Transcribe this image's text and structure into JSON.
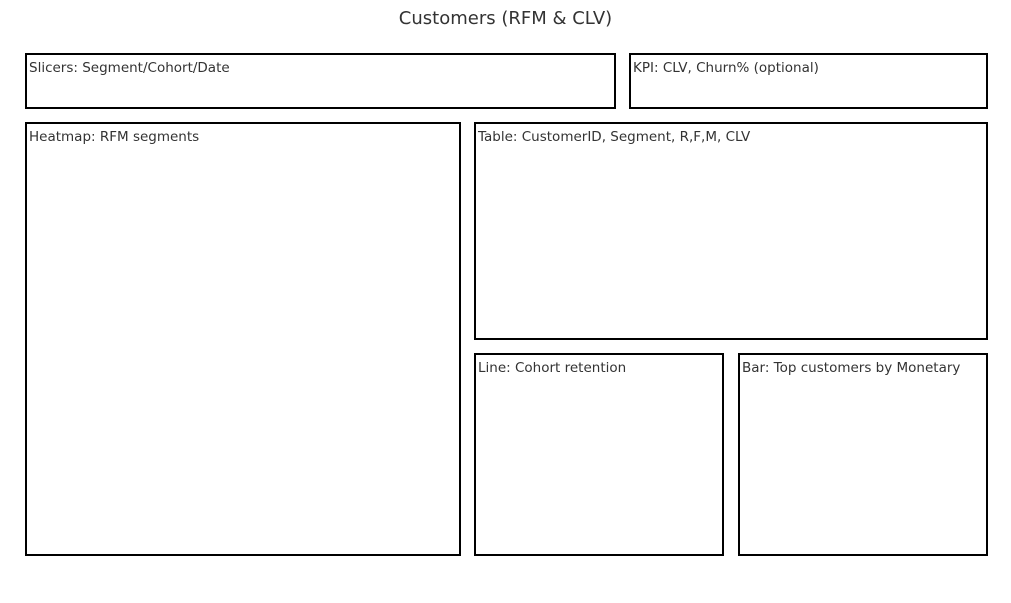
{
  "title": "Customers (RFM & CLV)",
  "panels": {
    "slicers": "Slicers: Segment/Cohort/Date",
    "kpi": "KPI: CLV, Churn% (optional)",
    "heatmap": "Heatmap: RFM segments",
    "table": "Table: CustomerID, Segment, R,F,M, CLV",
    "line": "Line: Cohort retention",
    "bar": "Bar: Top customers by Monetary"
  }
}
